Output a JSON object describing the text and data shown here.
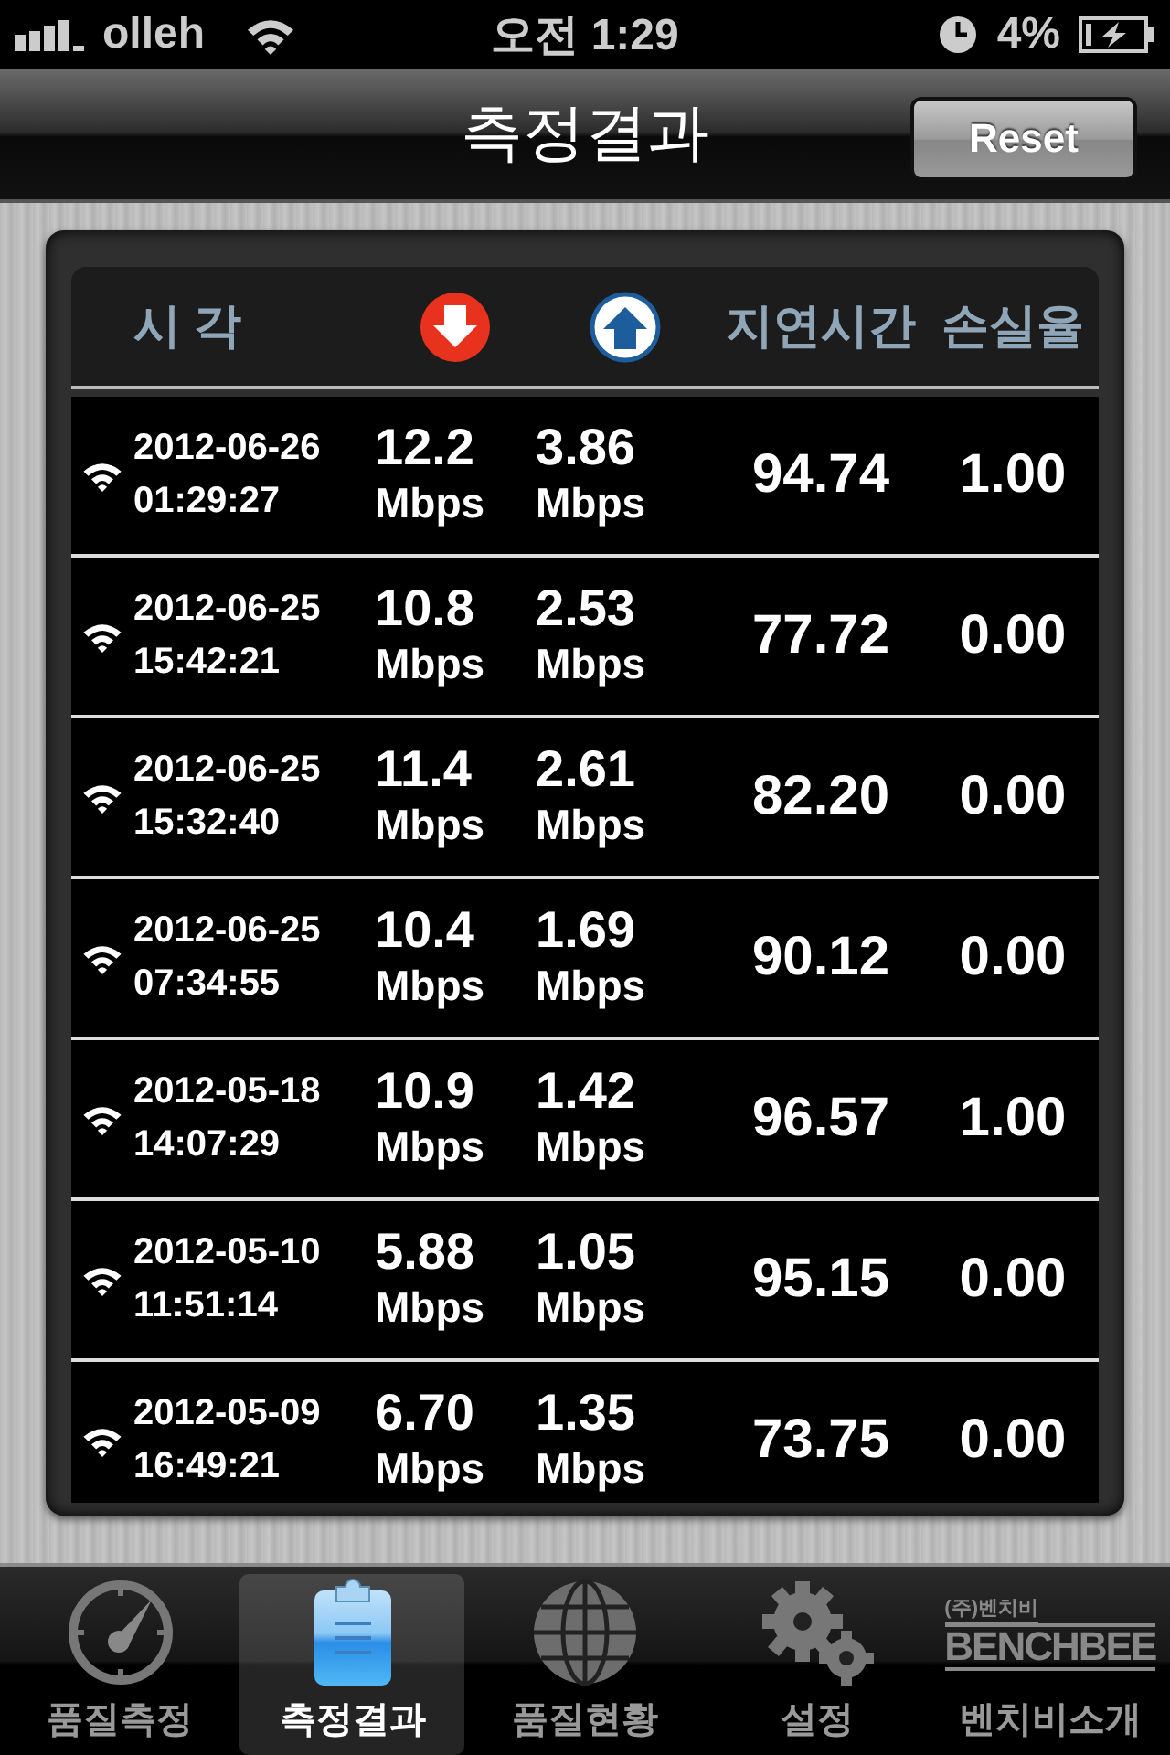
{
  "status_bar": {
    "carrier": "olleh",
    "time": "오전 1:29",
    "battery": "4%"
  },
  "nav_bar": {
    "title": "측정결과",
    "button": "Reset"
  },
  "table": {
    "columns": [
      {
        "kind": "text",
        "label": "시 각"
      },
      {
        "kind": "download"
      },
      {
        "kind": "upload"
      },
      {
        "kind": "text",
        "label": "지연시간"
      },
      {
        "kind": "text",
        "label": "손실율"
      }
    ],
    "rows": [
      {
        "date": "2012-06-26",
        "time": "01:29:27",
        "down": "12.2",
        "down_unit": "Mbps",
        "up": "3.86",
        "up_unit": "Mbps",
        "latency": "94.74",
        "loss": "1.00"
      },
      {
        "date": "2012-06-25",
        "time": "15:42:21",
        "down": "10.8",
        "down_unit": "Mbps",
        "up": "2.53",
        "up_unit": "Mbps",
        "latency": "77.72",
        "loss": "0.00"
      },
      {
        "date": "2012-06-25",
        "time": "15:32:40",
        "down": "11.4",
        "down_unit": "Mbps",
        "up": "2.61",
        "up_unit": "Mbps",
        "latency": "82.20",
        "loss": "0.00"
      },
      {
        "date": "2012-06-25",
        "time": "07:34:55",
        "down": "10.4",
        "down_unit": "Mbps",
        "up": "1.69",
        "up_unit": "Mbps",
        "latency": "90.12",
        "loss": "0.00"
      },
      {
        "date": "2012-05-18",
        "time": "14:07:29",
        "down": "10.9",
        "down_unit": "Mbps",
        "up": "1.42",
        "up_unit": "Mbps",
        "latency": "96.57",
        "loss": "1.00"
      },
      {
        "date": "2012-05-10",
        "time": "11:51:14",
        "down": "5.88",
        "down_unit": "Mbps",
        "up": "1.05",
        "up_unit": "Mbps",
        "latency": "95.15",
        "loss": "0.00"
      },
      {
        "date": "2012-05-09",
        "time": "16:49:21",
        "down": "6.70",
        "down_unit": "Mbps",
        "up": "1.35",
        "up_unit": "Mbps",
        "latency": "73.75",
        "loss": "0.00"
      }
    ]
  },
  "tab_bar": {
    "tabs": [
      {
        "kind": "gauge",
        "label": "품질측정",
        "selected": false
      },
      {
        "kind": "clipboard",
        "label": "측정결과",
        "selected": true
      },
      {
        "kind": "globe",
        "label": "품질현황",
        "selected": false
      },
      {
        "kind": "gears",
        "label": "설정",
        "selected": false
      },
      {
        "kind": "logo",
        "label": "벤치비소개",
        "selected": false,
        "logo_small": "(주)벤치비",
        "logo_big": "BENCHBEE"
      }
    ]
  }
}
